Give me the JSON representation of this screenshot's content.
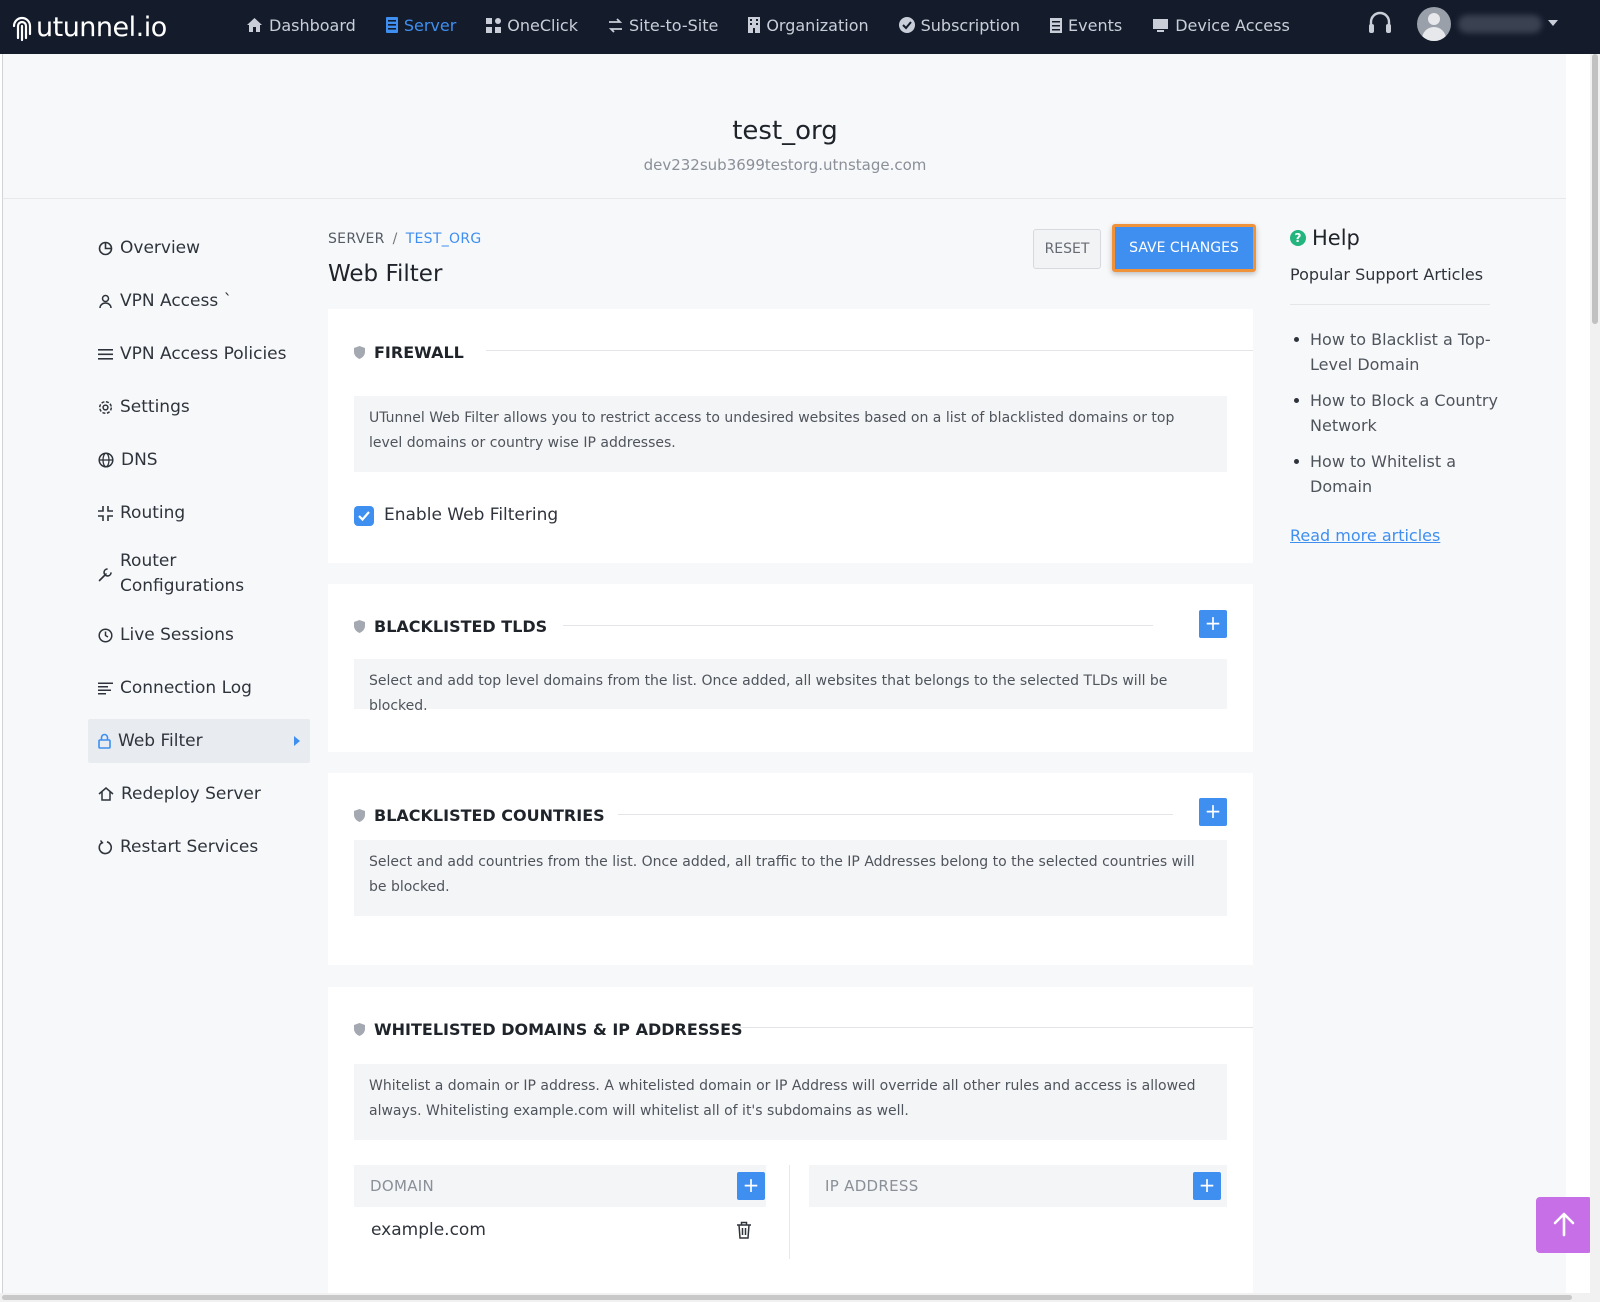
{
  "brand": {
    "name": "utunnel.io"
  },
  "nav": {
    "items": [
      {
        "label": "Dashboard",
        "icon": "home-icon"
      },
      {
        "label": "Server",
        "icon": "server-icon",
        "active": true
      },
      {
        "label": "OneClick",
        "icon": "grid-icon"
      },
      {
        "label": "Site-to-Site",
        "icon": "swap-icon"
      },
      {
        "label": "Organization",
        "icon": "building-icon"
      },
      {
        "label": "Subscription",
        "icon": "check-circle-icon"
      },
      {
        "label": "Events",
        "icon": "list-icon"
      },
      {
        "label": "Device Access",
        "icon": "monitor-icon"
      }
    ],
    "active_color": "#3f8ff0"
  },
  "header": {
    "org_name": "test_org",
    "org_domain": "dev232sub3699testorg.utnstage.com"
  },
  "sidebar": {
    "items": [
      {
        "label": "Overview",
        "icon": "pie-chart-icon"
      },
      {
        "label": "VPN Access `",
        "icon": "user-icon"
      },
      {
        "label": "VPN Access Policies",
        "icon": "list-icon"
      },
      {
        "label": "Settings",
        "icon": "gear-icon"
      },
      {
        "label": "DNS",
        "icon": "globe-icon"
      },
      {
        "label": "Routing",
        "icon": "routing-icon"
      },
      {
        "label": "Router Configurations",
        "icon": "wrench-icon"
      },
      {
        "label": "Live Sessions",
        "icon": "clock-icon"
      },
      {
        "label": "Connection Log",
        "icon": "log-icon"
      },
      {
        "label": "Web Filter",
        "icon": "lock-icon",
        "active": true
      },
      {
        "label": "Redeploy Server",
        "icon": "redeploy-icon"
      },
      {
        "label": "Restart Services",
        "icon": "restart-icon"
      }
    ]
  },
  "breadcrumb": {
    "root": "SERVER",
    "separator": "/",
    "current": "TEST_ORG"
  },
  "page": {
    "title": "Web Filter",
    "reset_label": "RESET",
    "save_label": "SAVE CHANGES"
  },
  "firewall": {
    "title": "FIREWALL",
    "description": "UTunnel Web Filter allows you to restrict access to undesired websites based on a list of blacklisted domains or top level domains or country wise IP addresses.",
    "checkbox_label": "Enable Web Filtering",
    "checkbox_checked": true
  },
  "tlds": {
    "title": "BLACKLISTED TLDS",
    "description": "Select and add top level domains from the list. Once added, all websites that belongs to the selected TLDs will be blocked.",
    "add_label": "+"
  },
  "countries": {
    "title": "BLACKLISTED COUNTRIES",
    "description": "Select and add countries from the list. Once added, all traffic to the IP Addresses belong to the selected countries will be blocked.",
    "add_label": "+"
  },
  "whitelist": {
    "title": "WHITELISTED DOMAINS & IP ADDRESSES",
    "description": "Whitelist a domain or IP address. A whitelisted domain or IP Address will override all other rules and access is allowed always. Whitelisting example.com will whitelist all of it's subdomains as well.",
    "domain_header": "DOMAIN",
    "ip_header": "IP ADDRESS",
    "add_label": "+",
    "domains": [
      "example.com"
    ]
  },
  "help": {
    "title": "Help",
    "subtitle": "Popular Support Articles",
    "articles": [
      "How to Blacklist a Top-Level Domain",
      "How to Block a Country Network",
      "How to Whitelist a Domain"
    ],
    "read_more": "Read more articles"
  },
  "colors": {
    "nav_bg": "#141c2c",
    "accent": "#3f8ff0",
    "save_outline": "#f0923a",
    "scroll_top_button": "#c66fe6",
    "help_icon": "#24b47e"
  }
}
